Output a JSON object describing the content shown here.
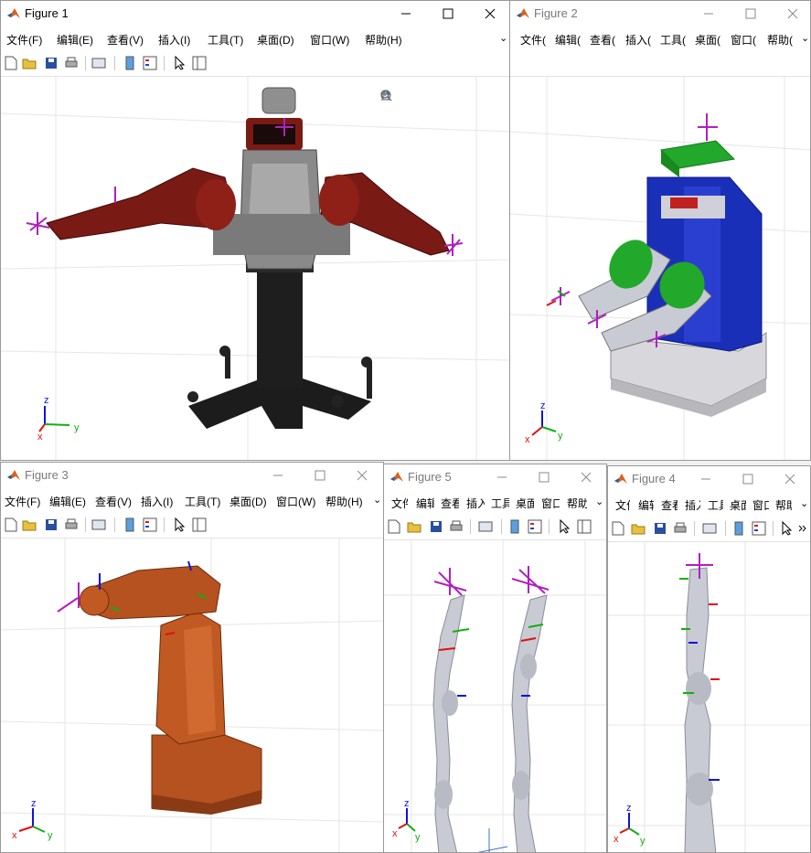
{
  "colors": {
    "matlab_orange": "#d9621e",
    "matlab_blue": "#1c5fa8",
    "baxter_red": "#7a1a14",
    "pr2_blue": "#1a2fb8",
    "pr2_green": "#22a82a",
    "irb_orange": "#b5521f",
    "kinova_gray": "#c9cbd4",
    "frame_magenta": "#b020c0",
    "axis_x": "#e01010",
    "axis_y": "#10b010",
    "axis_z": "#1010e0"
  },
  "windows": {
    "fig1": {
      "title": "Figure 1",
      "menus": [
        "文件(F)",
        "编辑(E)",
        "查看(V)",
        "插入(I)",
        "工具(T)",
        "桌面(D)",
        "窗口(W)",
        "帮助(H)"
      ],
      "robot": "baxter",
      "axis_labels": {
        "x": "x",
        "y": "y",
        "z": "z"
      }
    },
    "fig2": {
      "title": "Figure 2",
      "menus": [
        "文件(",
        "编辑(",
        "查看(",
        "插入(",
        "工具(",
        "桌面(",
        "窗口(",
        "帮助("
      ],
      "robot": "pr2",
      "axis_labels": {
        "x": "x",
        "y": "y",
        "z": "z"
      }
    },
    "fig3": {
      "title": "Figure 3",
      "menus": [
        "文件(F)",
        "编辑(E)",
        "查看(V)",
        "插入(I)",
        "工具(T)",
        "桌面(D)",
        "窗口(W)",
        "帮助(H)"
      ],
      "robot": "abb-irb",
      "axis_labels": {
        "x": "x",
        "y": "y",
        "z": "z"
      }
    },
    "fig5": {
      "title": "Figure 5",
      "menus": [
        "文件",
        "编辑",
        "查看",
        "插入",
        "工具",
        "桌面",
        "窗口",
        "帮助"
      ],
      "robot": "kinova-dual",
      "axis_labels": {
        "x": "x",
        "y": "y",
        "z": "z"
      }
    },
    "fig4": {
      "title": "Figure 4",
      "menus": [
        "文件",
        "编辑",
        "查看",
        "插入",
        "工具",
        "桌面",
        "窗口",
        "帮助"
      ],
      "robot": "kinova",
      "axis_labels": {
        "x": "x",
        "y": "y",
        "z": "z"
      }
    }
  },
  "icons": {
    "title": "matlab-logo-icon",
    "minimize": "minimize-icon",
    "maximize": "maximize-icon",
    "close": "close-icon",
    "toolbar": [
      "new-figure-icon",
      "open-file-icon",
      "save-icon",
      "print-icon",
      "link-plot-icon",
      "insert-colorbar-icon",
      "insert-legend-icon",
      "edit-plot-icon",
      "property-inspector-icon"
    ],
    "axes_toolbar": [
      "export-icon",
      "brush-icon",
      "rotate-3d-icon",
      "pan-icon",
      "zoom-in-icon",
      "zoom-out-icon",
      "home-icon"
    ]
  }
}
